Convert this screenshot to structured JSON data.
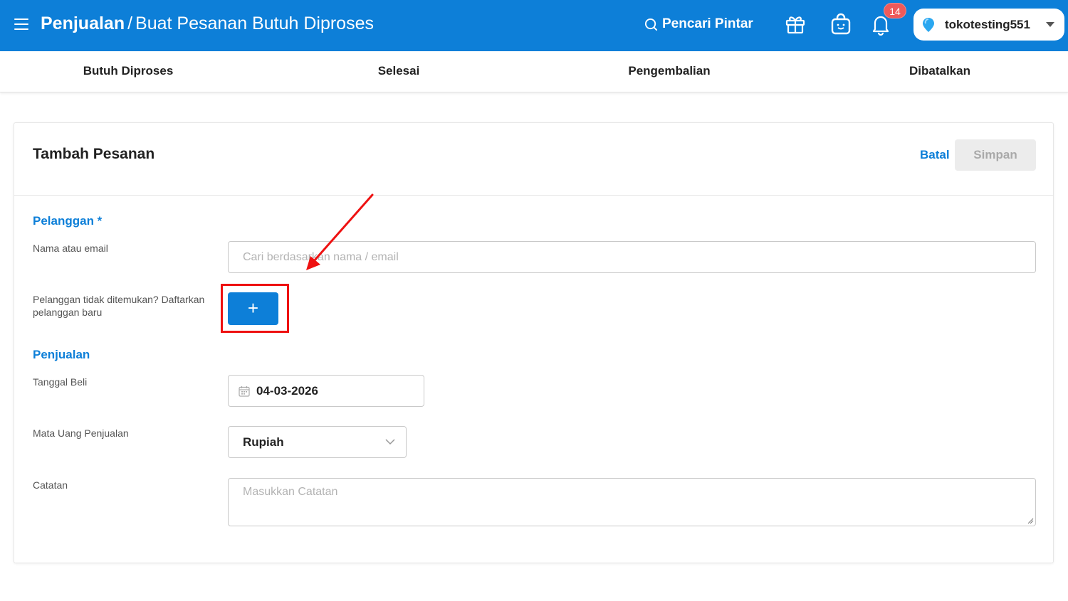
{
  "header": {
    "breadcrumb_root": "Penjualan",
    "breadcrumb_separator": "/",
    "page_title": "Buat Pesanan Butuh Diproses",
    "smart_search_label": "Pencari Pintar",
    "notification_count": "14",
    "store_name": "tokotesting551",
    "bar_color": "#0d7fd8"
  },
  "tabs": [
    {
      "label": "Butuh Diproses"
    },
    {
      "label": "Selesai"
    },
    {
      "label": "Pengembalian"
    },
    {
      "label": "Dibatalkan"
    }
  ],
  "form": {
    "title": "Tambah Pesanan",
    "cancel_label": "Batal",
    "save_label": "Simpan",
    "customer_section": "Pelanggan *",
    "name_or_email_label": "Nama atau email",
    "name_or_email_placeholder": "Cari berdasarkan nama / email",
    "customer_not_found_label": "Pelanggan tidak ditemukan? Daftarkan pelanggan baru",
    "add_customer_symbol": "+",
    "sales_section": "Penjualan",
    "purchase_date_label": "Tanggal Beli",
    "purchase_date_value": "04-03-2026",
    "currency_label": "Mata Uang Penjualan",
    "currency_value": "Rupiah",
    "notes_label": "Catatan",
    "notes_placeholder": "Masukkan Catatan"
  },
  "icons": {
    "menu": "hamburger-icon",
    "search": "search-icon",
    "gift": "gift-icon",
    "bag": "shopping-bag-icon",
    "bell": "bell-icon",
    "store": "location-pin-icon",
    "calendar": "calendar-icon",
    "dropdown": "chevron-down-icon"
  },
  "annotation": {
    "highlight_color": "#ee1111"
  }
}
